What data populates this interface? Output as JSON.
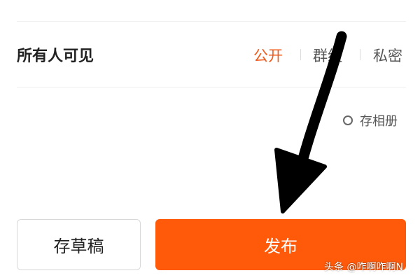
{
  "visibility": {
    "label": "所有人可见",
    "options": [
      "公开",
      "群组",
      "私密"
    ],
    "selected": "公开"
  },
  "album": {
    "label": "存相册",
    "checked": false
  },
  "actions": {
    "draft_label": "存草稿",
    "publish_label": "发布"
  },
  "watermark": "头条 @咋啊咋啊N",
  "colors": {
    "accent": "#ff5a0a",
    "selected_text": "#f05a1a",
    "arrow": "#000000"
  }
}
